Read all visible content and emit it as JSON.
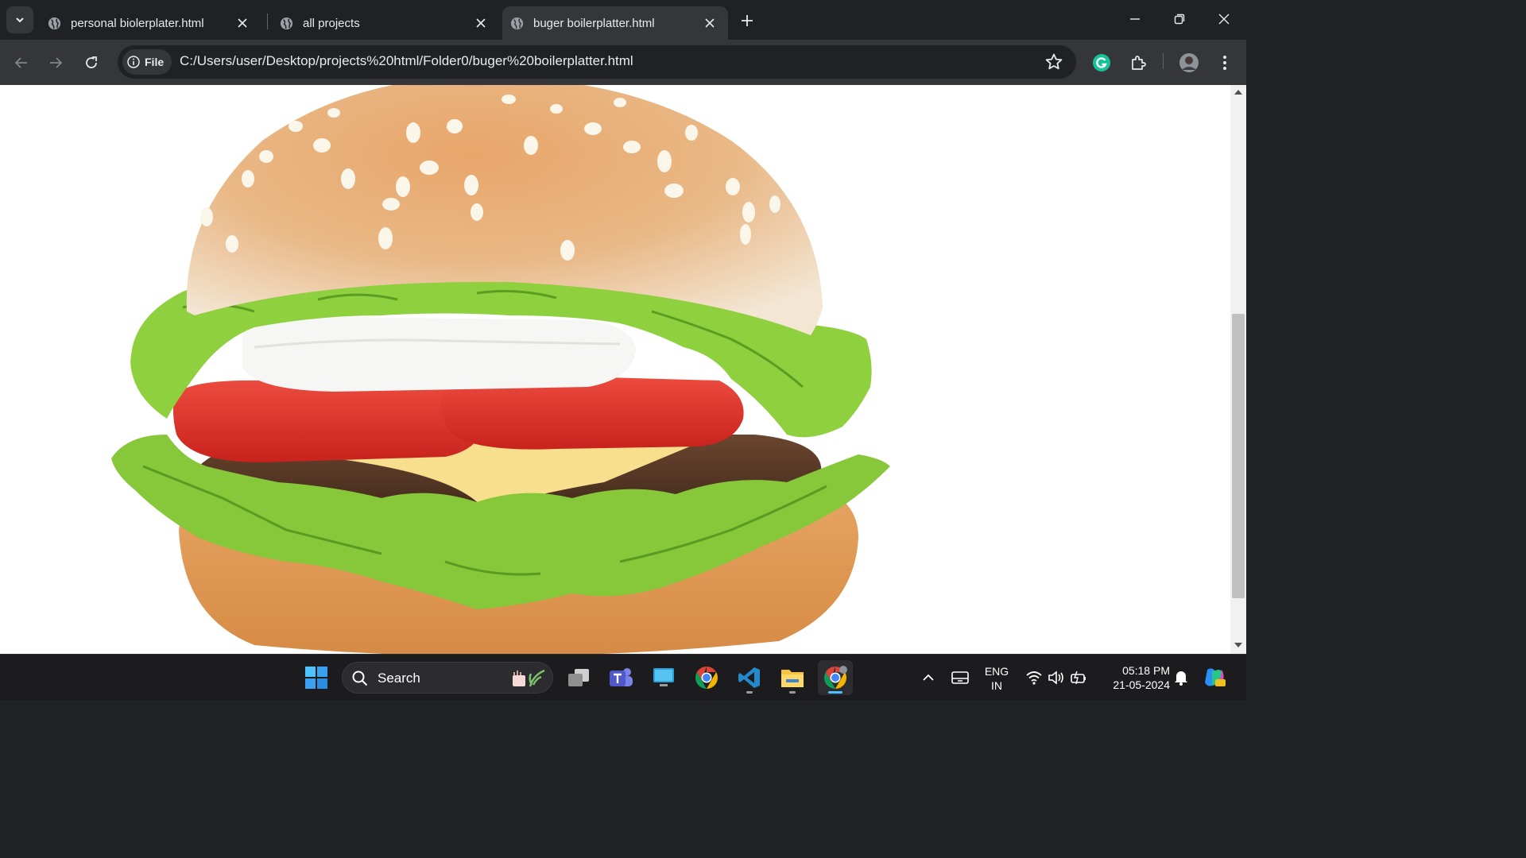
{
  "browser": {
    "tabs": [
      {
        "title": "personal biolerplater.html",
        "active": false
      },
      {
        "title": "all projects",
        "active": false
      },
      {
        "title": "buger boilerplatter.html",
        "active": true
      }
    ],
    "address_bar": {
      "scheme_chip": "File",
      "url": "C:/Users/user/Desktop/projects%20html/Folder0/buger%20boilerplatter.html"
    },
    "icons": [
      "tab-search-icon",
      "globe-icon",
      "close-icon",
      "plus-icon",
      "minimize-icon",
      "restore-icon",
      "back-icon",
      "forward-icon",
      "reload-icon",
      "info-icon",
      "star-icon",
      "grammarly-icon",
      "extensions-icon",
      "profile-avatar",
      "menu-icon"
    ]
  },
  "page": {
    "content": "burger image",
    "background": "#ffffff"
  },
  "taskbar": {
    "search_label": "Search",
    "apps": [
      "start-icon",
      "task-view-icon",
      "teams-icon",
      "desktop-icon",
      "chrome-icon",
      "vscode-icon",
      "file-explorer-icon",
      "chrome-profile-icon"
    ],
    "tray": {
      "language_line1": "ENG",
      "language_line2": "IN",
      "time": "05:18 PM",
      "date": "21-05-2024"
    }
  },
  "colors": {
    "titlebar": "#202124",
    "toolbar": "#35363a",
    "text": "#e8eaed",
    "accent": "#4cc2ff",
    "taskbar": "#1c1c1f"
  }
}
